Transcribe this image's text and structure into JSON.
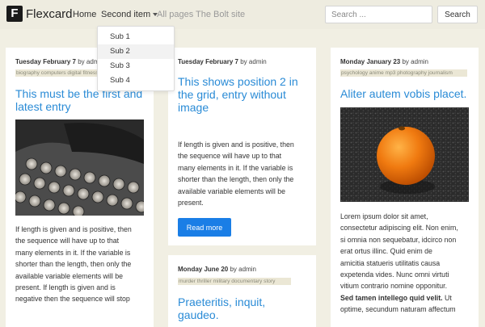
{
  "navbar": {
    "logo_letter": "F",
    "brand": "Flexcard",
    "links": [
      {
        "label": "Home"
      },
      {
        "label": "Second item"
      },
      {
        "label": "All pages"
      },
      {
        "label": "The Bolt site"
      }
    ],
    "search": {
      "placeholder": "Search ...",
      "value": "",
      "button_label": "Search"
    }
  },
  "dropdown": {
    "items": [
      {
        "label": "Sub 1"
      },
      {
        "label": "Sub 2"
      },
      {
        "label": "Sub 3"
      },
      {
        "label": "Sub 4"
      }
    ],
    "hovered_index": 1
  },
  "cards": [
    {
      "date": "Tuesday February 7",
      "by": "by",
      "author": "admin",
      "tags": "biography computers digital fitness",
      "title_line1": "This must be the first and",
      "title_line2": "latest entry",
      "image_icon": "typewriter-image",
      "body": [
        "If length is given and is positive, then",
        "the sequence will have up to that",
        "many elements in it. If the variable is",
        "shorter than the length, then only the",
        "available variable elements will be",
        "present. If length is given and is",
        "negative then the sequence will stop"
      ]
    },
    {
      "date": "Tuesday February 7",
      "by": "by",
      "author": "admin",
      "title_line1": "This shows position 2 in",
      "title_line2": "the grid, entry without",
      "title_line3": "image",
      "body": [
        "If length is given and is positive, then",
        "the sequence will have up to that",
        "many elements in it. If the variable is",
        "shorter than the length, then only the",
        "available variable elements will be",
        "present."
      ],
      "button_label": "Read more"
    },
    {
      "date": "Monday June 20",
      "by": "by",
      "author": "admin",
      "tags": "murder thriller military documentary story",
      "title_line1": "Praeteritis, inquit,",
      "title_line2": "gaudeo."
    },
    {
      "date": "Monday January 23",
      "by": "by",
      "author": "admin",
      "tags": "psychology anime mp3 photography journalism",
      "title_line1": "Aliter autem vobis placet.",
      "image_icon": "orange-image",
      "body": [
        "Lorem ipsum dolor sit amet,",
        "consectetur adipiscing elit. Non enim,",
        "si omnia non sequebatur, idcirco non",
        "erat ortus illinc. Quid enim de",
        "amicitia statueris utilitatis causa",
        "expetenda vides. Nunc omni virtuti",
        "vitium contrario nomine opponitur."
      ],
      "body_bold": "Sed tamen intellego quid velit.",
      "body_after": " Ut",
      "body_tail": [
        "optime, secundum naturam affectum"
      ]
    }
  ],
  "colors": {
    "background": "#f1efe3",
    "link_blue": "#2a8bd6",
    "button_blue": "#1a7ee6",
    "tag_bg": "#ebe7d5"
  }
}
